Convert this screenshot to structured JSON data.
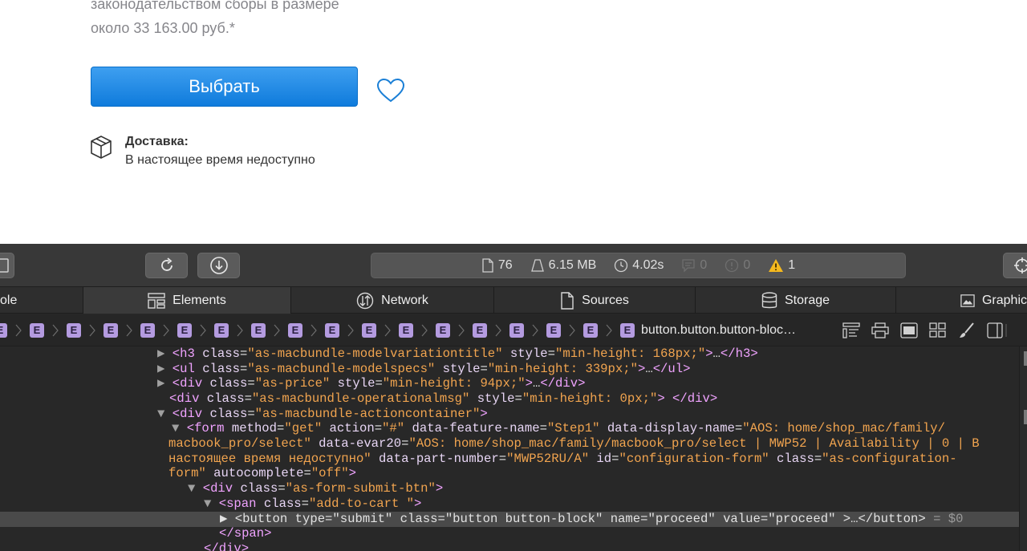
{
  "page": {
    "price_line1": "законодательством сборы в размере",
    "price_line2": "около 33 163.00 руб.*",
    "select_label": "Выбрать",
    "delivery_title": "Доставка:",
    "delivery_status": "В настоящее время недоступно"
  },
  "devtools": {
    "stats": {
      "resources": "76",
      "size": "6.15 MB",
      "time": "4.02s",
      "logs": "0",
      "errors": "0",
      "warnings": "1"
    },
    "tabs": [
      {
        "label": "ole"
      },
      {
        "label": "Elements"
      },
      {
        "label": "Network"
      },
      {
        "label": "Sources"
      },
      {
        "label": "Storage"
      },
      {
        "label": "Graphic"
      }
    ],
    "breadcrumb": {
      "element_badge": "E",
      "selected": "button.button.button-bloc…"
    },
    "dom_selected_suffix": "= $0"
  },
  "colors": {
    "button": "#1a86e0",
    "devtools_bg": "#282828",
    "warning": "#f5b91e"
  }
}
